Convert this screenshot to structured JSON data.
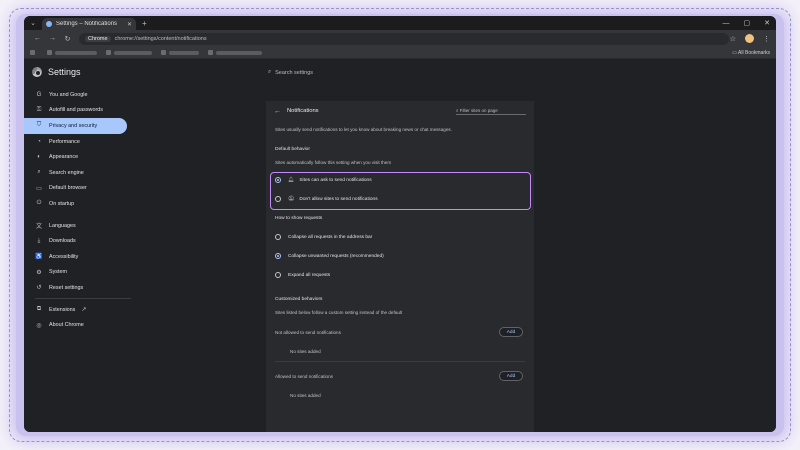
{
  "tab": {
    "title": "Settings – Notifications"
  },
  "omnibox": {
    "chip": "Chrome",
    "url": "chrome://settings/content/notifications"
  },
  "bookmarks": {
    "all": "All Bookmarks"
  },
  "settings": {
    "title": "Settings",
    "search_placeholder": "Search settings"
  },
  "sidebar": {
    "items": [
      {
        "label": "You and Google",
        "icon": "google-icon"
      },
      {
        "label": "Autofill and passwords",
        "icon": "key-icon"
      },
      {
        "label": "Privacy and security",
        "icon": "shield-icon"
      },
      {
        "label": "Performance",
        "icon": "speedometer-icon"
      },
      {
        "label": "Appearance",
        "icon": "palette-icon"
      },
      {
        "label": "Search engine",
        "icon": "search-icon"
      },
      {
        "label": "Default browser",
        "icon": "browser-icon"
      },
      {
        "label": "On startup",
        "icon": "power-icon"
      },
      {
        "label": "Languages",
        "icon": "translate-icon"
      },
      {
        "label": "Downloads",
        "icon": "download-icon"
      },
      {
        "label": "Accessibility",
        "icon": "accessibility-icon"
      },
      {
        "label": "System",
        "icon": "wrench-icon"
      },
      {
        "label": "Reset settings",
        "icon": "reset-icon"
      },
      {
        "label": "Extensions",
        "icon": "puzzle-icon"
      },
      {
        "label": "About Chrome",
        "icon": "chrome-icon"
      }
    ],
    "active_index": 2
  },
  "notifications": {
    "title": "Notifications",
    "filter_placeholder": "Filter sites on page",
    "intro": "Sites usually send notifications to let you know about breaking news or chat messages.",
    "default_behavior": {
      "heading": "Default behavior",
      "sub": "Sites automatically follow this setting when you visit them",
      "options": [
        {
          "label": "Sites can ask to send notifications",
          "selected": true
        },
        {
          "label": "Don't allow sites to send notifications",
          "selected": false
        }
      ]
    },
    "requests": {
      "heading": "How to show requests",
      "options": [
        {
          "label": "Collapse all requests in the address bar",
          "selected": false
        },
        {
          "label": "Collapse unwanted requests (recommended)",
          "selected": true
        },
        {
          "label": "Expand all requests",
          "selected": false
        }
      ]
    },
    "customized": {
      "heading": "Customized behaviors",
      "sub": "Sites listed below follow a custom setting instead of the default",
      "not_allowed_label": "Not allowed to send notifications",
      "not_allowed_empty": "No sites added",
      "allowed_label": "Allowed to send notifications",
      "allowed_empty": "No sites added",
      "add_label": "Add"
    }
  },
  "colors": {
    "accent": "#a8c7fa",
    "highlight": "#c58af9",
    "background": "#202124"
  }
}
